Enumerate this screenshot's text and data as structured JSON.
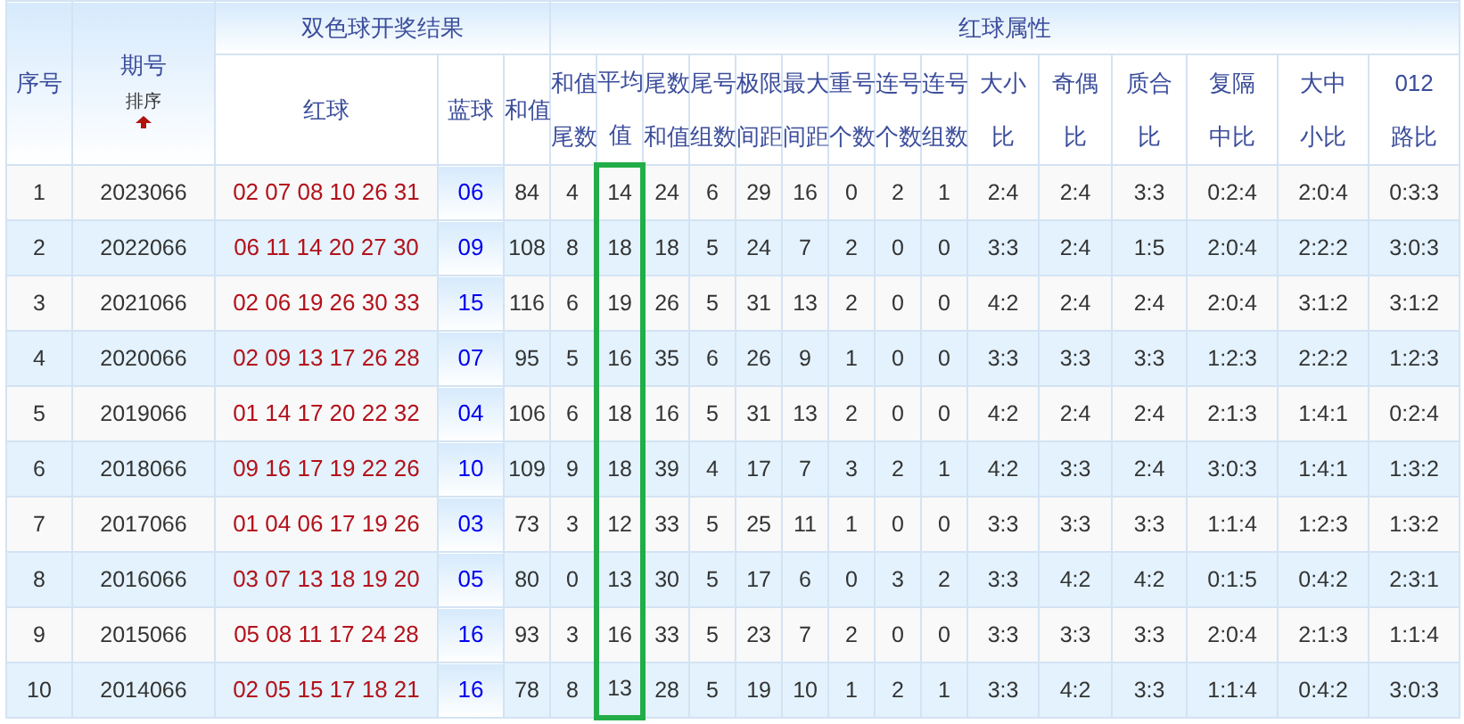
{
  "header_groups": [
    {
      "label": "序号",
      "kind": "single"
    },
    {
      "label": "期号",
      "kind": "sortable",
      "sort_label": "排序",
      "sorted_ascending": true
    },
    {
      "label": "双色球开奖结果",
      "kind": "group",
      "columns": [
        {
          "label": "红球",
          "kind": "red"
        },
        {
          "label": "蓝球",
          "kind": "blue"
        },
        {
          "label": "和值",
          "kind": "plain"
        }
      ]
    },
    {
      "label": "红球属性",
      "kind": "group",
      "columns": [
        {
          "label": "和值尾数",
          "kind": "plain"
        },
        {
          "label": "平均值",
          "kind": "plain",
          "highlighted": true
        },
        {
          "label": "尾数和值",
          "kind": "plain"
        },
        {
          "label": "尾号组数",
          "kind": "plain"
        },
        {
          "label": "极限间距",
          "kind": "plain"
        },
        {
          "label": "最大间距",
          "kind": "plain"
        },
        {
          "label": "重号个数",
          "kind": "plain"
        },
        {
          "label": "连号个数",
          "kind": "plain"
        },
        {
          "label": "连号组数",
          "kind": "plain"
        },
        {
          "label": "大小比",
          "kind": "ratio"
        },
        {
          "label": "奇偶比",
          "kind": "ratio"
        },
        {
          "label": "质合比",
          "kind": "ratio"
        },
        {
          "label": "复隔中比",
          "kind": "ratio"
        },
        {
          "label": "大中小比",
          "kind": "ratio"
        },
        {
          "label": "012路比",
          "kind": "ratio"
        }
      ]
    }
  ],
  "rows": [
    {
      "index": "1",
      "issue": "2023066",
      "cells": [
        "02 07 08 10 26 31",
        "06",
        "84",
        "4",
        "14",
        "24",
        "6",
        "29",
        "16",
        "0",
        "2",
        "1",
        "2:4",
        "2:4",
        "3:3",
        "0:2:4",
        "2:0:4",
        "0:3:3"
      ]
    },
    {
      "index": "2",
      "issue": "2022066",
      "cells": [
        "06 11 14 20 27 30",
        "09",
        "108",
        "8",
        "18",
        "18",
        "5",
        "24",
        "7",
        "2",
        "0",
        "0",
        "3:3",
        "2:4",
        "1:5",
        "2:0:4",
        "2:2:2",
        "3:0:3"
      ]
    },
    {
      "index": "3",
      "issue": "2021066",
      "cells": [
        "02 06 19 26 30 33",
        "15",
        "116",
        "6",
        "19",
        "26",
        "5",
        "31",
        "13",
        "2",
        "0",
        "0",
        "4:2",
        "2:4",
        "2:4",
        "2:0:4",
        "3:1:2",
        "3:1:2"
      ]
    },
    {
      "index": "4",
      "issue": "2020066",
      "cells": [
        "02 09 13 17 26 28",
        "07",
        "95",
        "5",
        "16",
        "35",
        "6",
        "26",
        "9",
        "1",
        "0",
        "0",
        "3:3",
        "3:3",
        "3:3",
        "1:2:3",
        "2:2:2",
        "1:2:3"
      ]
    },
    {
      "index": "5",
      "issue": "2019066",
      "cells": [
        "01 14 17 20 22 32",
        "04",
        "106",
        "6",
        "18",
        "16",
        "5",
        "31",
        "13",
        "2",
        "0",
        "0",
        "4:2",
        "2:4",
        "2:4",
        "2:1:3",
        "1:4:1",
        "0:2:4"
      ]
    },
    {
      "index": "6",
      "issue": "2018066",
      "cells": [
        "09 16 17 19 22 26",
        "10",
        "109",
        "9",
        "18",
        "39",
        "4",
        "17",
        "7",
        "3",
        "2",
        "1",
        "4:2",
        "3:3",
        "2:4",
        "3:0:3",
        "1:4:1",
        "1:3:2"
      ]
    },
    {
      "index": "7",
      "issue": "2017066",
      "cells": [
        "01 04 06 17 19 26",
        "03",
        "73",
        "3",
        "12",
        "33",
        "5",
        "25",
        "11",
        "1",
        "0",
        "0",
        "3:3",
        "3:3",
        "3:3",
        "1:1:4",
        "1:2:3",
        "1:3:2"
      ]
    },
    {
      "index": "8",
      "issue": "2016066",
      "cells": [
        "03 07 13 18 19 20",
        "05",
        "80",
        "0",
        "13",
        "30",
        "5",
        "17",
        "6",
        "0",
        "3",
        "2",
        "3:3",
        "4:2",
        "4:2",
        "0:1:5",
        "0:4:2",
        "2:3:1"
      ]
    },
    {
      "index": "9",
      "issue": "2015066",
      "cells": [
        "05 08 11 17 24 28",
        "16",
        "93",
        "3",
        "16",
        "33",
        "5",
        "23",
        "7",
        "2",
        "0",
        "0",
        "3:3",
        "3:3",
        "3:3",
        "2:0:4",
        "2:1:3",
        "1:1:4"
      ]
    },
    {
      "index": "10",
      "issue": "2014066",
      "cells": [
        "02 05 15 17 18 21",
        "16",
        "78",
        "8",
        "13",
        "28",
        "5",
        "19",
        "10",
        "1",
        "2",
        "1",
        "3:3",
        "4:2",
        "3:3",
        "1:1:4",
        "0:4:2",
        "3:0:3"
      ]
    }
  ]
}
